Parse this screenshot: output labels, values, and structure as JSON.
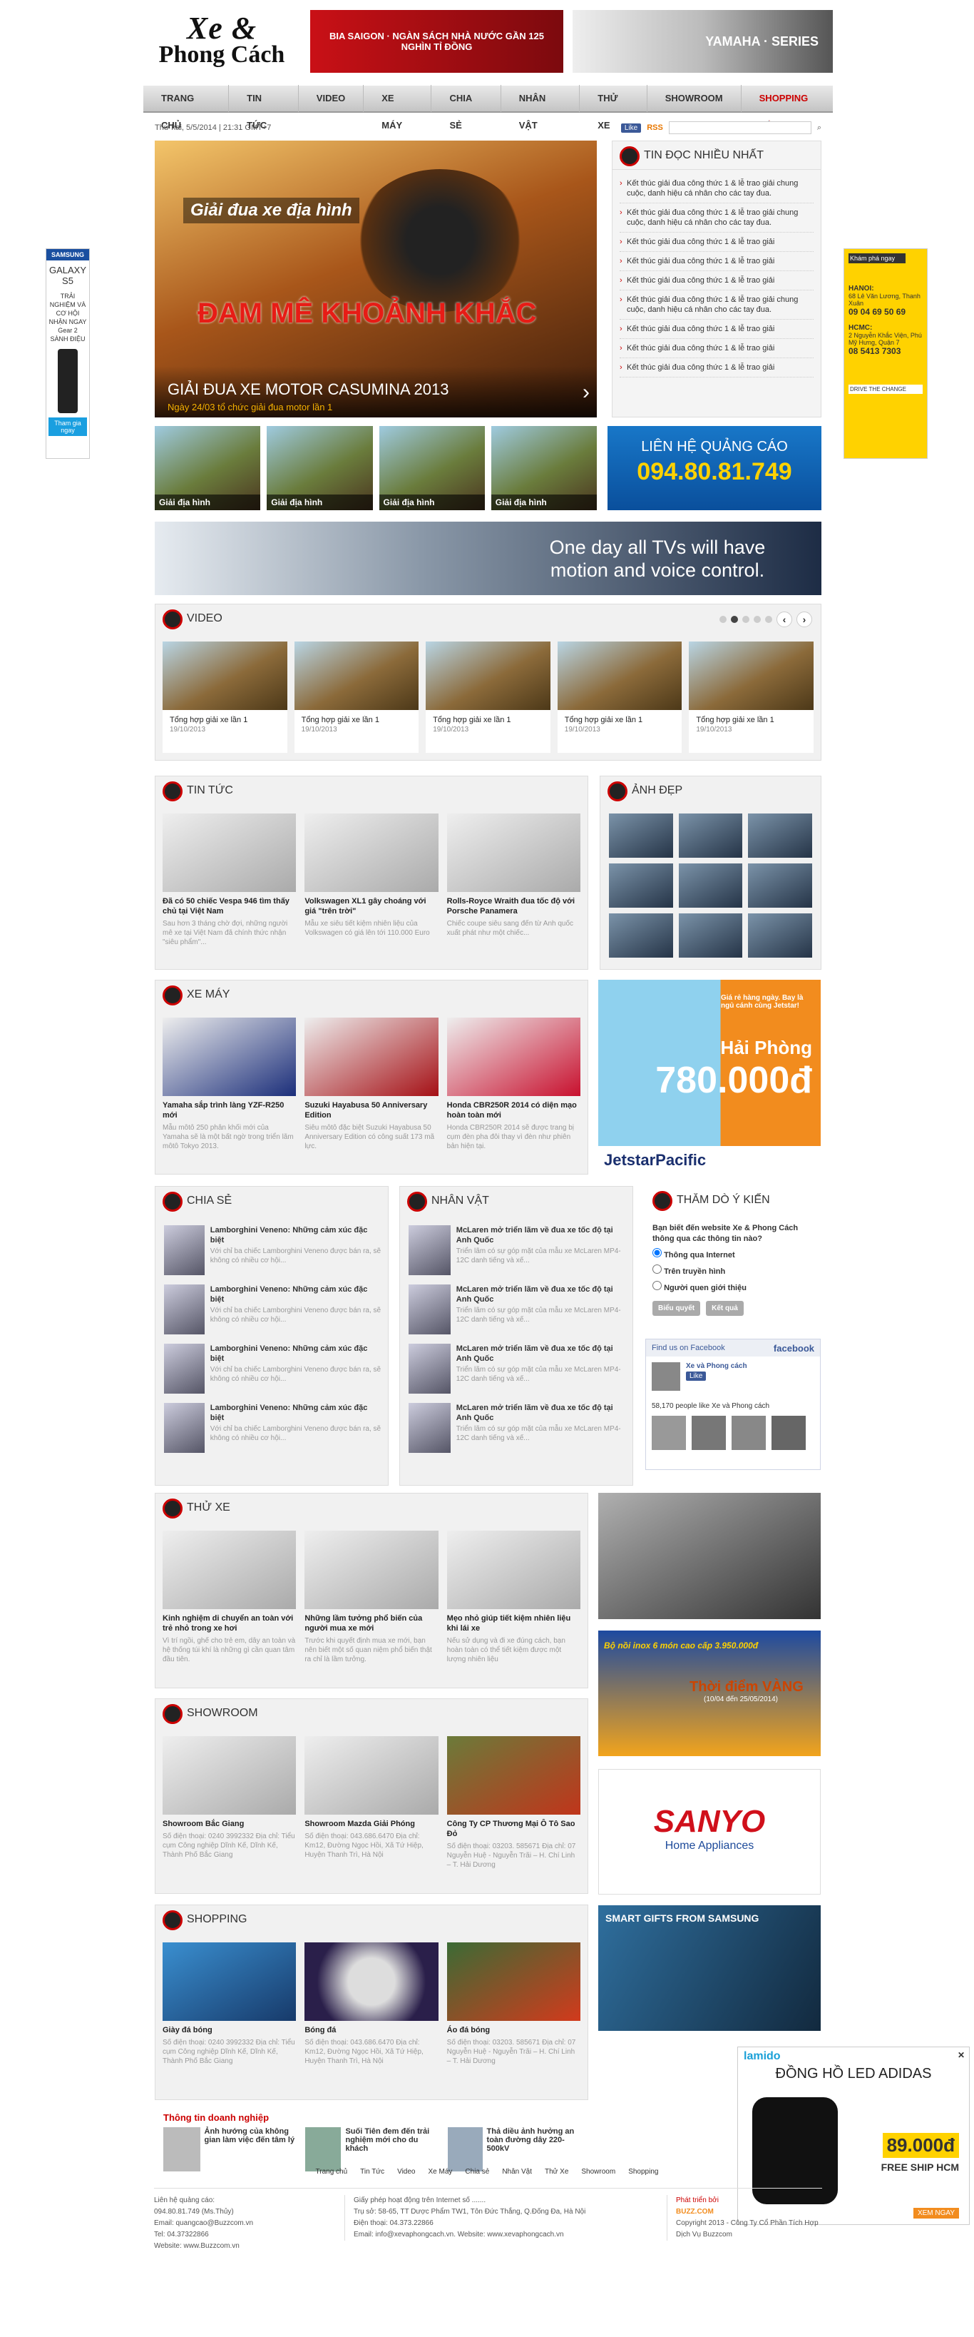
{
  "logo": {
    "line1": "Xe &",
    "line2": "Phong Cách"
  },
  "top_banners": {
    "b1": "BIA SAIGON · NGÀN SÁCH NHÀ NƯỚC GẦN 125 NGHÌN TỈ ĐỒNG",
    "b2": "YAMAHA · SERIES"
  },
  "nav": [
    "Trang chủ",
    "Tin tức",
    "Video",
    "Xe máy",
    "Chia sẻ",
    "Nhân vật",
    "Thử xe",
    "Showroom",
    "Shopping"
  ],
  "date": "Thứ hai, 5/5/2014 | 21:31 GMT+7",
  "fb_like": "Like",
  "rss": "RSS",
  "slider": {
    "t1": "Giải đua xe địa hình",
    "t2": "ĐAM MÊ KHOẢNH KHẮC",
    "title": "GIẢI ĐUA XE MOTOR CASUMINA 2013",
    "sub": "Ngày 24/03 tổ chức giải đua motor lần 1"
  },
  "thumbs": [
    "Giải địa hình",
    "Giải địa hình",
    "Giải địa hình",
    "Giải địa hình"
  ],
  "mostread": {
    "title": "Tin đọc nhiều nhất",
    "items": [
      "Kết thúc giải đua công thức 1 & lễ trao giải chung cuộc, danh hiệu cá nhân cho các tay đua.",
      "Kết thúc giải đua công thức 1 & lễ trao giải chung cuộc, danh hiệu cá nhân cho các tay đua.",
      "Kết thúc giải đua công thức 1 & lễ trao giải",
      "Kết thúc giải đua công thức 1 & lễ trao giải",
      "Kết thúc giải đua công thức 1 & lễ trao giải",
      "Kết thúc giải đua công thức 1 & lễ trao giải chung cuộc, danh hiệu cá nhân cho các tay đua.",
      "Kết thúc giải đua công thức 1 & lễ trao giải",
      "Kết thúc giải đua công thức 1 & lễ trao giải",
      "Kết thúc giải đua công thức 1 & lễ trao giải"
    ]
  },
  "contact": {
    "a": "LIÊN HỆ QUẢNG CÁO",
    "b": "094.80.81.749"
  },
  "tv": {
    "text": "One day all TVs will have motion and voice control."
  },
  "video": {
    "title": "Video",
    "items": [
      {
        "t": "Tổng hợp giải xe lần 1",
        "d": "19/10/2013"
      },
      {
        "t": "Tổng hợp giải xe lần 1",
        "d": "19/10/2013"
      },
      {
        "t": "Tổng hợp giải xe lần 1",
        "d": "19/10/2013"
      },
      {
        "t": "Tổng hợp giải xe lần 1",
        "d": "19/10/2013"
      },
      {
        "t": "Tổng hợp giải xe lần 1",
        "d": "19/10/2013"
      }
    ]
  },
  "tintuc": {
    "title": "Tin tức",
    "items": [
      {
        "t": "Đã có 50 chiếc Vespa 946 tìm thấy chủ tại Việt Nam",
        "d": "Sau hơn 3 tháng chờ đợi, những người mê xe tại Việt Nam đã chính thức nhận \"siêu phẩm\"..."
      },
      {
        "t": "Volkswagen XL1 gây choáng với giá \"trên trời\"",
        "d": "Mẫu xe siêu tiết kiệm nhiên liệu của Volkswagen có giá lên tới 110.000 Euro"
      },
      {
        "t": "Rolls-Royce Wraith đua tốc độ với Porsche Panamera",
        "d": "Chiếc coupe siêu sang đến từ Anh quốc xuất phát như một chiếc..."
      }
    ]
  },
  "anhdep": {
    "title": "Ảnh đẹp"
  },
  "xemay": {
    "title": "Xe máy",
    "items": [
      {
        "t": "Yamaha sắp trình làng YZF-R250 mới",
        "d": "Mẫu môtô 250 phân khối mới của Yamaha sẽ là một bất ngờ trong triển lãm môtô Tokyo 2013."
      },
      {
        "t": "Suzuki Hayabusa 50 Anniversary Edition",
        "d": "Siêu môtô đặc biệt Suzuki Hayabusa 50 Anniversary Edition có công suất 173 mã lực."
      },
      {
        "t": "Honda CBR250R 2014 có diện mạo hoàn toàn mới",
        "d": "Honda CBR250R 2014 sẽ được trang bị cụm đèn pha đôi thay vì đèn như phiên bản hiện tại."
      }
    ]
  },
  "jetstar": {
    "a": "Giá rẻ hàng ngày. Bay là ngủ cánh cùng Jetstar!",
    "city": "Hải Phòng",
    "price": "780.000đ",
    "brand": "JetstarPacific"
  },
  "chiase": {
    "title": "Chia sẻ",
    "items": [
      {
        "t": "Lamborghini Veneno: Những cảm xúc đặc biệt",
        "d": "Với chỉ ba chiếc Lamborghini Veneno được bán ra, sẽ không có nhiều cơ hội..."
      },
      {
        "t": "Lamborghini Veneno: Những cảm xúc đặc biệt",
        "d": "Với chỉ ba chiếc Lamborghini Veneno được bán ra, sẽ không có nhiều cơ hội..."
      },
      {
        "t": "Lamborghini Veneno: Những cảm xúc đặc biệt",
        "d": "Với chỉ ba chiếc Lamborghini Veneno được bán ra, sẽ không có nhiều cơ hội..."
      },
      {
        "t": "Lamborghini Veneno: Những cảm xúc đặc biệt",
        "d": "Với chỉ ba chiếc Lamborghini Veneno được bán ra, sẽ không có nhiều cơ hội..."
      }
    ]
  },
  "nhanvat": {
    "title": "Nhân vật",
    "items": [
      {
        "t": "McLaren mở triển lãm về đua xe tốc độ tại Anh Quốc",
        "d": "Triển lãm có sự góp mặt của mẫu xe McLaren MP4-12C danh tiếng và xế..."
      },
      {
        "t": "McLaren mở triển lãm về đua xe tốc độ tại Anh Quốc",
        "d": "Triển lãm có sự góp mặt của mẫu xe McLaren MP4-12C danh tiếng và xế..."
      },
      {
        "t": "McLaren mở triển lãm về đua xe tốc độ tại Anh Quốc",
        "d": "Triển lãm có sự góp mặt của mẫu xe McLaren MP4-12C danh tiếng và xế..."
      },
      {
        "t": "McLaren mở triển lãm về đua xe tốc độ tại Anh Quốc",
        "d": "Triển lãm có sự góp mặt của mẫu xe McLaren MP4-12C danh tiếng và xế..."
      }
    ]
  },
  "poll": {
    "title": "Thăm dò ý kiến",
    "q": "Bạn biết đến website Xe & Phong Cách thông qua các thông tin nào?",
    "opts": [
      "Thông qua Internet",
      "Trên truyền hình",
      "Người quen giới thiệu"
    ],
    "b1": "Biểu quyết",
    "b2": "Kết quả"
  },
  "facebook": {
    "h": "Find us on Facebook",
    "brand": "facebook",
    "page": "Xe và Phong cách",
    "like": "Like",
    "count": "58,170 people like Xe và Phong cách"
  },
  "thuxe": {
    "title": "Thử xe",
    "items": [
      {
        "t": "Kinh nghiệm di chuyển an toàn với trẻ nhỏ trong xe hơi",
        "d": "Vì trí ngồi, ghế cho trẻ em, dây an toàn và hệ thống túi khí là những gì cần quan tâm đầu tiên."
      },
      {
        "t": "Những lầm tưởng phổ biến của người mua xe mới",
        "d": "Trước khi quyết định mua xe mới, bạn nên biết một số quan niệm phổ biến thật ra chỉ là lầm tưởng."
      },
      {
        "t": "Mẹo nhỏ giúp tiết kiệm nhiên liệu khi lái xe",
        "d": "Nếu sử dụng và đi xe đúng cách, bạn hoàn toàn có thể tiết kiệm được một lượng nhiên liệu"
      }
    ]
  },
  "showroom": {
    "title": "Showroom",
    "items": [
      {
        "t": "Showroom Bắc Giang",
        "d": "Số điện thoại: 0240 3992332 Địa chỉ: Tiểu cụm Công nghiệp Dĩnh Kế, Dĩnh Kế, Thành Phố Bắc Giang"
      },
      {
        "t": "Showroom Mazda Giải Phóng",
        "d": "Số điện thoại: 043.686.6470 Địa chỉ: Km12, Đường Ngọc Hồi, Xã Tứ Hiệp, Huyện Thanh Trì, Hà Nội"
      },
      {
        "t": "Công Ty CP Thương Mại Ô Tô Sao Đỏ",
        "d": "Số điện thoại: 03203. 585671 Địa chỉ: 07 Nguyễn Huệ - Nguyễn Trãi – H. Chí Linh – T. Hải Dương"
      }
    ]
  },
  "shopping": {
    "title": "Shopping",
    "items": [
      {
        "t": "Giày đá bóng",
        "d": "Số điện thoại: 0240 3992332 Địa chỉ: Tiểu cụm Công nghiệp Dĩnh Kế, Dĩnh Kế, Thành Phố Bắc Giang"
      },
      {
        "t": "Bóng đá",
        "d": "Số điện thoại: 043.686.6470 Địa chỉ: Km12, Đường Ngọc Hồi, Xã Tứ Hiệp, Huyện Thanh Trì, Hà Nội"
      },
      {
        "t": "Áo đá bóng",
        "d": "Số điện thoại: 03203. 585671 Địa chỉ: 07 Nguyễn Huệ - Nguyễn Trãi – H. Chí Linh – T. Hải Dương"
      }
    ]
  },
  "ads": {
    "inox": "Bộ nồi inox 6 món cao cấp 3.950.000đ",
    "vang": "Thời điểm VÀNG",
    "vang_date": "(10/04 đến 25/05/2014)",
    "sanyo": "SANYO",
    "sanyo_sub": "Home Appliances",
    "smart": "SMART GIFTS FROM SAMSUNG"
  },
  "doanhnghiep": {
    "title": "Thông tin doanh nghiệp",
    "items": [
      "Ảnh hướng của không gian làm việc đến tâm lý",
      "Suối Tiên đem đến trải nghiệm mới cho du khách",
      "Thả diều ảnh hưởng an toàn đường dây 220-500kV"
    ]
  },
  "popup": {
    "brand": "lamido",
    "title": "ĐỒNG HỒ LED ADIDAS",
    "price": "89.000đ",
    "ship": "FREE SHIP HCM",
    "btn": "XEM NGAY"
  },
  "sideL": {
    "brand": "SAMSUNG",
    "model": "GALAXY S5",
    "text": "TRẢI NGHIỆM VÀ CƠ HỘI NHẬN NGAY Gear 2 SÀNH ĐIỆU",
    "btn": "Tham gia ngay"
  },
  "sideR": {
    "h": "Khám phá ngay",
    "hanoi": "HANOI:",
    "addr1": "68 Lê Văn Lương, Thanh Xuân",
    "ph1": "09 04 69 50 69",
    "hcm": "HCMC:",
    "addr2": "2 Nguyễn Khắc Viện, Phú Mỹ Hưng, Quận 7",
    "ph2": "08 5413 7303",
    "foot": "DRIVE THE CHANGE"
  },
  "footer": {
    "nav": [
      "Trang chủ",
      "Tin Tức",
      "Video",
      "Xe Máy",
      "Chia sẻ",
      "Nhân Vật",
      "Thử Xe",
      "Showroom",
      "Shopping"
    ],
    "c1": [
      "Liên hệ quảng cáo:",
      "094.80.81.749 (Ms.Thủy)",
      "Email: quangcao@Buzzcom.vn",
      "Tel: 04.37322866",
      "Website: www.Buzzcom.vn"
    ],
    "c2": [
      "Giấy phép hoạt động trên Internet số .......",
      "Trụ sở: 58-65, TT Dược Phẩm TW1, Tôn Đức Thắng, Q.Đống Đa, Hà Nội",
      "Điện thoại: 04.373.22866",
      "Email: info@xevaphongcach.vn. Website: www.xevaphongcach.vn"
    ],
    "c3": [
      "Phát triển bởi",
      "BUZZ.COM",
      "Copyright 2013 - Công Ty Cổ Phần Tích Hợp Dịch Vụ Buzzcom"
    ]
  }
}
